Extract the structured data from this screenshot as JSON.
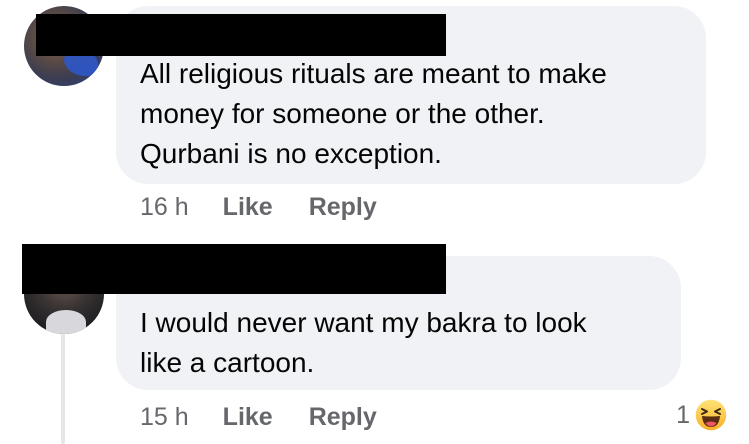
{
  "comments": [
    {
      "text": "All religious rituals are meant to make\nmoney for someone or the other.\nQurbani is no exception.",
      "timestamp": "16 h",
      "like_label": "Like",
      "reply_label": "Reply"
    },
    {
      "text": "I would never want my bakra to look\nlike a cartoon.",
      "timestamp": "15 h",
      "like_label": "Like",
      "reply_label": "Reply",
      "reaction_count": "1",
      "reaction_icon": "haha-emoji-icon"
    }
  ],
  "colors": {
    "bubble_bg": "#f0f2f5",
    "secondary_text": "#65676b",
    "primary_text": "#050505",
    "redaction": "#000000",
    "thread_line": "#e4e6eb"
  }
}
